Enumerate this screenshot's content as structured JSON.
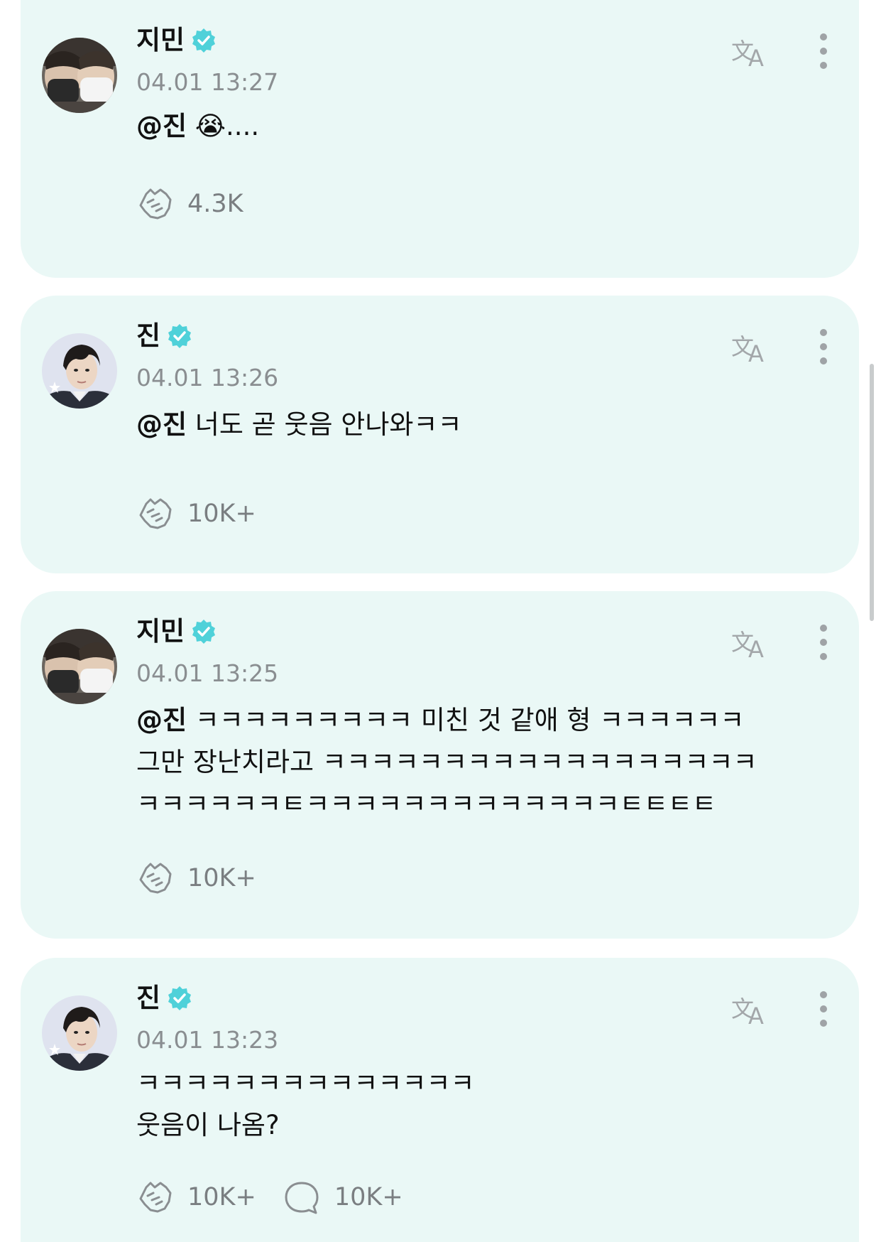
{
  "colors": {
    "card_bg": "#eaf8f6",
    "verified": "#4fd1d9",
    "muted": "#8a8e91"
  },
  "posts": [
    {
      "author": "지민",
      "verified": true,
      "timestamp": "04.01 13:27",
      "mention": "@진",
      "text": " 😭....",
      "reactions": "4.3K",
      "comments": null,
      "avatar": "jimin-avatar"
    },
    {
      "author": "진",
      "verified": true,
      "timestamp": "04.01 13:26",
      "mention": "@진",
      "text": " 너도 곧 웃음 안나와ㅋㅋ",
      "reactions": "10K+",
      "comments": null,
      "avatar": "jin-avatar"
    },
    {
      "author": "지민",
      "verified": true,
      "timestamp": "04.01 13:25",
      "mention": "@진",
      "text": " ㅋㅋㅋㅋㅋㅋㅋㅋㅋ 미친 것 같애 형 ㅋㅋㅋㅋㅋㅋ\n그만 장난치라고 ㅋㅋㅋㅋㅋㅋㅋㅋㅋㅋㅋㅋㅋㅋㅋㅋㅋㅋ\nㅋㅋㅋㅋㅋㅋㅌㅋㅋㅋㅋㅋㅋㅋㅋㅋㅋㅋㅋㅋㅌㅌㅌㅌ",
      "reactions": "10K+",
      "comments": null,
      "avatar": "jimin-avatar"
    },
    {
      "author": "진",
      "verified": true,
      "timestamp": "04.01 13:23",
      "mention": "",
      "text": "ㅋㅋㅋㅋㅋㅋㅋㅋㅋㅋㅋㅋㅋㅋ\n웃음이 나옴?",
      "reactions": "10K+",
      "comments": "10K+",
      "avatar": "jin-avatar"
    }
  ]
}
